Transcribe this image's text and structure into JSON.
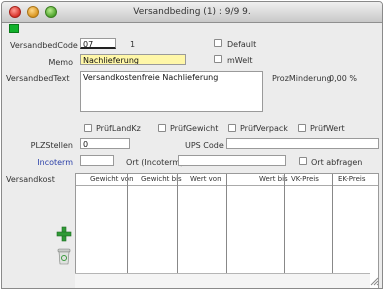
{
  "window": {
    "title": "Versandbeding (1) : 9/9 9."
  },
  "form": {
    "versandbedcode": {
      "label": "VersandbedCode",
      "value": "07",
      "number": "1"
    },
    "default": {
      "label": "Default"
    },
    "mwelt": {
      "label": "mWelt"
    },
    "memo": {
      "label": "Memo",
      "value": "Nachlieferung"
    },
    "versandbedtext": {
      "label": "VersandbedText",
      "value": "Versandkostenfreie Nachlieferung"
    },
    "prozminderung": {
      "label": "ProzMinderung",
      "value": "0,00 %"
    },
    "checks": {
      "pruflandkz": "PrüfLandKz",
      "prufgewicht": "PrüfGewicht",
      "prufverpack": "PrüfVerpack",
      "prufwert": "PrüfWert"
    },
    "plzstellen": {
      "label": "PLZStellen",
      "value": "0"
    },
    "upscode": {
      "label": "UPS Code",
      "value": ""
    },
    "incoterm": {
      "label": "Incoterm",
      "value": ""
    },
    "ortincoterm": {
      "label": "Ort (Incoterm)",
      "value": ""
    },
    "ortabfragen": {
      "label": "Ort abfragen"
    },
    "versandkost": {
      "label": "Versandkost"
    }
  },
  "grid": {
    "columns": [
      "Gewicht von",
      "Gewicht bis",
      "Wert von",
      "Wert bis",
      "VK-Preis",
      "EK-Preis"
    ]
  },
  "icons": {
    "add": "plus-icon",
    "delete": "trash-icon"
  },
  "colors": {
    "memo_highlight": "#fff7a8",
    "status_flag": "#12b12c",
    "link": "#2a3fa8"
  }
}
